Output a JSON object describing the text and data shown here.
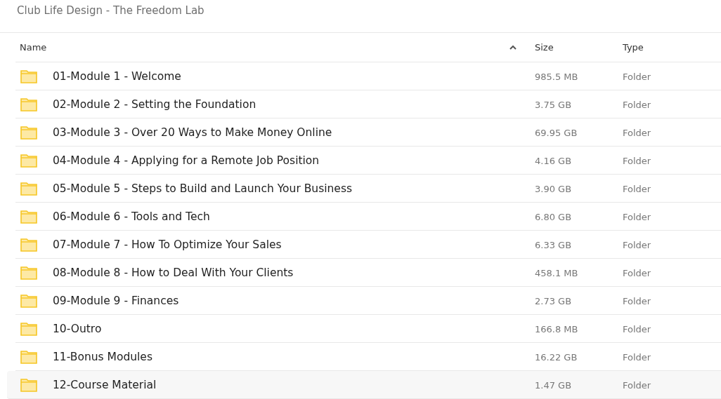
{
  "title": "Club Life Design - The Freedom Lab",
  "columns": [
    {
      "label": "Name",
      "sorted": true
    },
    {
      "label": "Size",
      "sorted": false
    },
    {
      "label": "Type",
      "sorted": false
    }
  ],
  "rows": [
    {
      "name": "01-Module 1 - Welcome",
      "size": "985.5 MB",
      "type": "Folder",
      "selected": false
    },
    {
      "name": "02-Module 2 - Setting the Foundation",
      "size": "3.75 GB",
      "type": "Folder",
      "selected": false
    },
    {
      "name": "03-Module 3 - Over 20 Ways to Make Money Online",
      "size": "69.95 GB",
      "type": "Folder",
      "selected": false
    },
    {
      "name": "04-Module 4 - Applying for a Remote Job Position",
      "size": "4.16 GB",
      "type": "Folder",
      "selected": false
    },
    {
      "name": "05-Module 5 - Steps to Build and Launch Your Business",
      "size": "3.90 GB",
      "type": "Folder",
      "selected": false
    },
    {
      "name": "06-Module 6 - Tools and Tech",
      "size": "6.80 GB",
      "type": "Folder",
      "selected": false
    },
    {
      "name": "07-Module 7 - How To Optimize Your Sales",
      "size": "6.33 GB",
      "type": "Folder",
      "selected": false
    },
    {
      "name": "08-Module 8 - How to Deal With Your Clients",
      "size": "458.1 MB",
      "type": "Folder",
      "selected": false
    },
    {
      "name": "09-Module 9 - Finances",
      "size": "2.73 GB",
      "type": "Folder",
      "selected": false
    },
    {
      "name": "10-Outro",
      "size": "166.8 MB",
      "type": "Folder",
      "selected": false
    },
    {
      "name": "11-Bonus Modules",
      "size": "16.22 GB",
      "type": "Folder",
      "selected": false
    },
    {
      "name": "12-Course Material",
      "size": "1.47 GB",
      "type": "Folder",
      "selected": true
    }
  ]
}
